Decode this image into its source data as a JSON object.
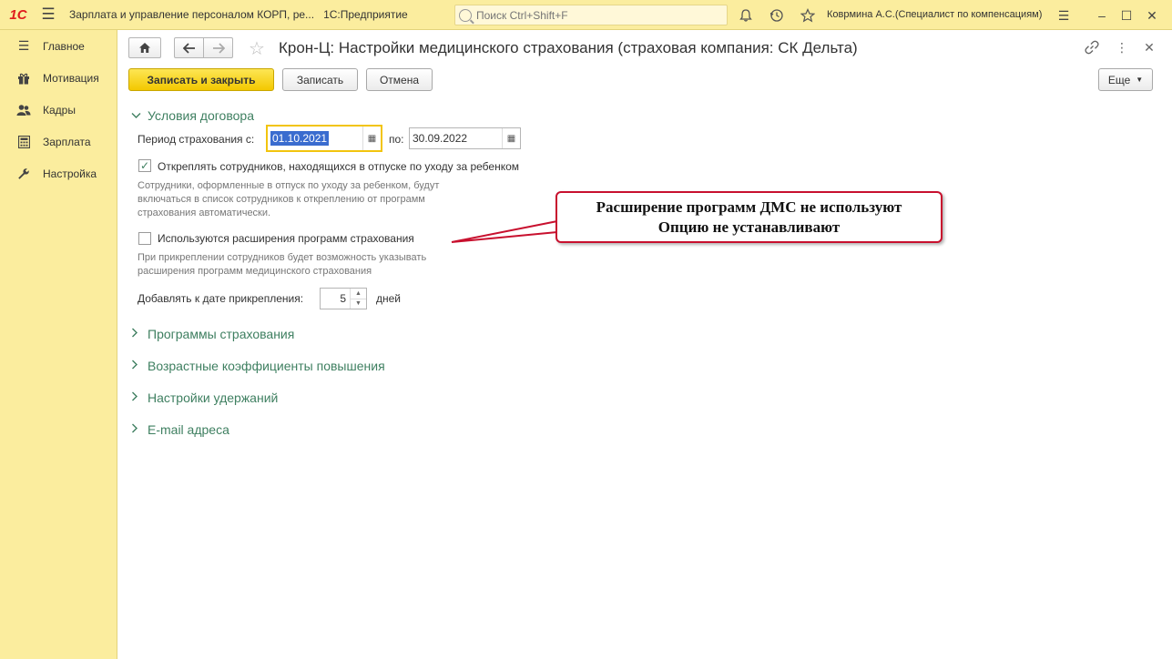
{
  "topbar": {
    "logo": "1С",
    "app_title": "Зарплата и управление персоналом КОРП, ре...",
    "platform": "1С:Предприятие",
    "search_placeholder": "Поиск Ctrl+Shift+F",
    "user": "Коврмина А.С.(Специалист по компенсациям)"
  },
  "sidebar": {
    "items": [
      {
        "label": "Главное",
        "icon": "menu-icon"
      },
      {
        "label": "Мотивация",
        "icon": "gift-icon"
      },
      {
        "label": "Кадры",
        "icon": "people-icon"
      },
      {
        "label": "Зарплата",
        "icon": "calculator-icon"
      },
      {
        "label": "Настройка",
        "icon": "wrench-icon"
      }
    ]
  },
  "form": {
    "title": "Крон-Ц: Настройки медицинского страхования (страховая компания: СК Дельта)",
    "buttons": {
      "save_close": "Записать и закрыть",
      "save": "Записать",
      "cancel": "Отмена",
      "more": "Еще"
    },
    "contract_group": {
      "title": "Условия договора",
      "period_label": "Период страхования с:",
      "date_from": "01.10.2021",
      "to_label": "по:",
      "date_to": "30.09.2022",
      "detach_checked": true,
      "detach_label": "Откреплять сотрудников, находящихся в отпуске по уходу за ребенком",
      "detach_hint": [
        "Сотрудники, оформленные в отпуск по уходу за ребенком, будут",
        "включаться в список сотрудников к откреплению от программ",
        "страхования автоматически."
      ],
      "extensions_checked": false,
      "extensions_label": "Используются расширения программ страхования",
      "extensions_hint": [
        "При прикреплении сотрудников будет возможность указывать",
        "расширения программ медицинского страхования"
      ],
      "add_days_label": "Добавлять к дате прикрепления:",
      "add_days_value": "5",
      "days_label": "дней"
    },
    "groups": [
      "Программы страхования",
      "Возрастные коэффициенты повышения",
      "Настройки удержаний",
      "E-mail адреса"
    ]
  },
  "callout": {
    "line1": "Расширение программ ДМС не используют",
    "line2": "Опцию не устанавливают"
  },
  "colors": {
    "accent_yellow": "#fbed9e",
    "group_green": "#3e7f60",
    "callout_red": "#c8102e"
  }
}
